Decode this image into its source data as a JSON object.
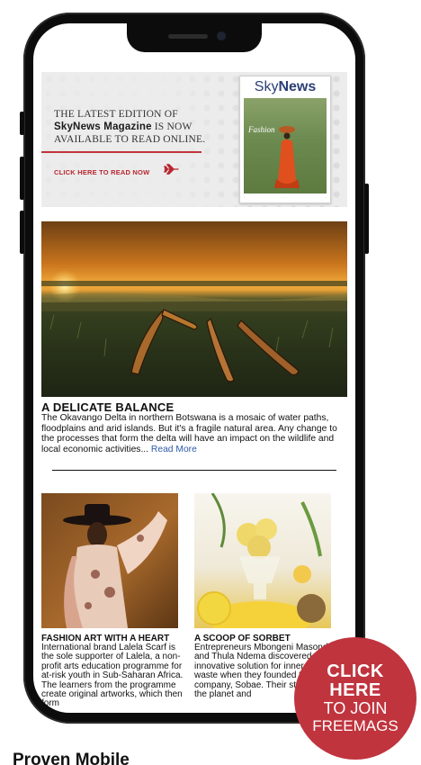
{
  "banner": {
    "line1": "THE LATEST EDITION OF",
    "brand": "SkyNews Magazine",
    "line2_suffix": " IS NOW",
    "line3": "AVAILABLE TO READ ONLINE.",
    "cta": "CLICK HERE TO READ NOW",
    "accent_color": "#c2333c"
  },
  "magazine": {
    "title_sky": "Sky",
    "title_news": "News",
    "cover_word": "Fashion"
  },
  "article": {
    "title": "A DELICATE BALANCE",
    "body": "The Okavango Delta in northern Botswana is a mosaic of water paths, floodplains and arid islands. But it's a fragile natural area. Any change to the processes that form the delta will have an impact on the wildlife and local economic activities... ",
    "read_more": "Read More"
  },
  "cards": [
    {
      "title": "FASHION ART WITH A HEART",
      "body": "International brand Lalela Scarf is the sole supporter of Lalela, a non-profit arts education programme for at-risk youth in Sub-Saharan Africa. The learners from the programme create original artworks, which then form"
    },
    {
      "title": "A SCOOP OF SORBET",
      "body": "Entrepreneurs Mbongeni Masondo and Thula Ndema discovered an innovative solution for inner-city food waste when they founded their sorbet company, Sobae. Their story: love for the planet and"
    }
  ],
  "cta_circle": {
    "line1": "CLICK",
    "line2": "HERE",
    "line3": "TO JOIN",
    "line4": "FREEMAGS",
    "color": "#c0343e"
  },
  "bottom_heading": "Proven Mobile"
}
